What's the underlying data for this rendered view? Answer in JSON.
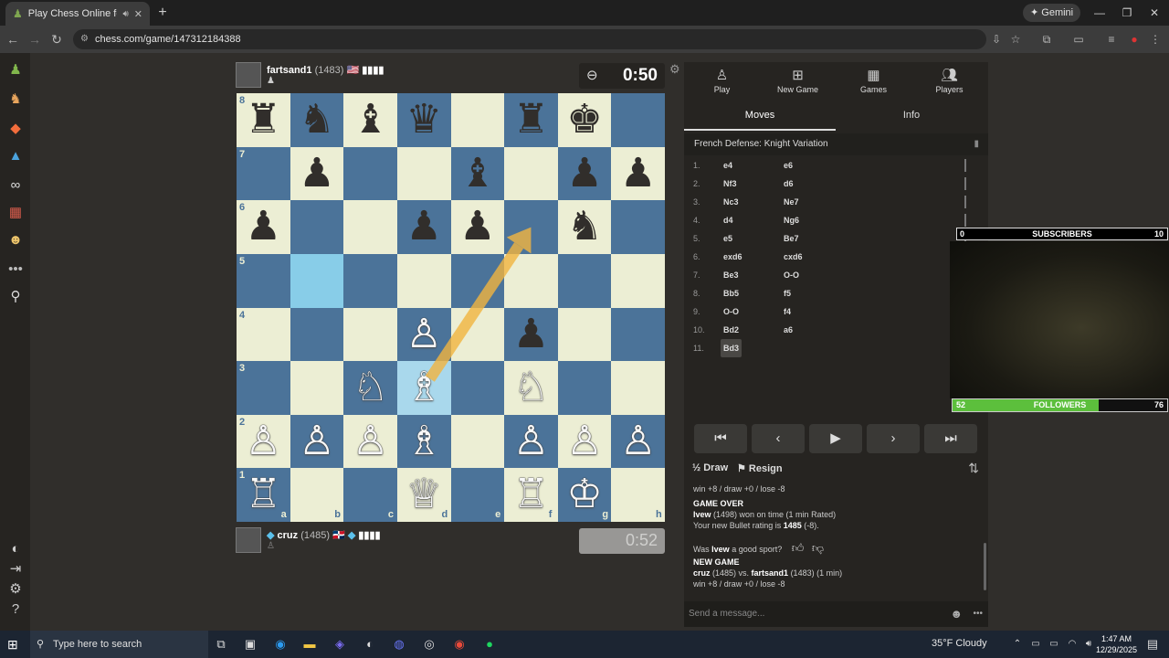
{
  "browser": {
    "tab_title": "Play Chess Online for FREE",
    "new_tab": "+",
    "gemini": "Gemini",
    "url": "chess.com/game/147312184388"
  },
  "top_player": {
    "name": "fartsand1",
    "rating": "(1483)",
    "flag": "🇺🇸",
    "signal": "▮▮▮▮",
    "clock": "0:50"
  },
  "bottom_player": {
    "name": "cruz",
    "rating": "(1485)",
    "flag": "🇩🇴",
    "signal": "▮▮▮▮",
    "clock": "0:52"
  },
  "board": {
    "ranks": [
      "8",
      "7",
      "6",
      "5",
      "4",
      "3",
      "2",
      "1"
    ],
    "files": [
      "a",
      "b",
      "c",
      "d",
      "e",
      "f",
      "g",
      "h"
    ],
    "pieces": [
      [
        "♜",
        "♞",
        "♝",
        "♛",
        "",
        "♜",
        "♚",
        ""
      ],
      [
        "",
        "♟",
        "",
        "",
        "♝",
        "",
        "♟",
        "♟"
      ],
      [
        "♟",
        "",
        "",
        "♟",
        "♟",
        "",
        "♞",
        ""
      ],
      [
        "",
        "",
        "",
        "",
        "",
        "",
        "",
        ""
      ],
      [
        "",
        "",
        "",
        "♙",
        "",
        "♟",
        "",
        ""
      ],
      [
        "",
        "",
        "♘",
        "♗",
        "",
        "♘",
        "",
        ""
      ],
      [
        "♙",
        "♙",
        "♙",
        "♗",
        "",
        "♙",
        "♙",
        "♙"
      ],
      [
        "♖",
        "",
        "",
        "♕",
        "",
        "♖",
        "♔",
        ""
      ]
    ],
    "colors": [
      [
        "b",
        "b",
        "b",
        "b",
        "",
        "b",
        "b",
        ""
      ],
      [
        "",
        "b",
        "",
        "",
        "b",
        "",
        "b",
        "b"
      ],
      [
        "b",
        "",
        "",
        "b",
        "b",
        "",
        "b",
        ""
      ],
      [
        "",
        "",
        "",
        "",
        "",
        "",
        "",
        ""
      ],
      [
        "",
        "",
        "",
        "w",
        "",
        "b",
        "",
        ""
      ],
      [
        "",
        "",
        "w",
        "w",
        "",
        "w",
        "",
        ""
      ],
      [
        "w",
        "w",
        "w",
        "w",
        "",
        "w",
        "w",
        "w"
      ],
      [
        "w",
        "",
        "",
        "w",
        "",
        "w",
        "w",
        ""
      ]
    ],
    "highlights": [
      "b5",
      "d3"
    ],
    "arrow": {
      "from": "d3",
      "to": "f6",
      "color": "#f2b540"
    }
  },
  "panel": {
    "tabs": [
      {
        "label": "Play",
        "icon": "pawn-icon"
      },
      {
        "label": "New Game",
        "icon": "plus-icon"
      },
      {
        "label": "Games",
        "icon": "board-icon"
      },
      {
        "label": "Players",
        "icon": "players-icon"
      }
    ],
    "subtabs": [
      "Moves",
      "Info"
    ],
    "opening": "French Defense: Knight Variation",
    "moves": [
      {
        "num": "1.",
        "w": "e4",
        "b": "e6"
      },
      {
        "num": "2.",
        "w": "Nf3",
        "b": "d6"
      },
      {
        "num": "3.",
        "w": "Nc3",
        "b": "Ne7"
      },
      {
        "num": "4.",
        "w": "d4",
        "b": "Ng6"
      },
      {
        "num": "5.",
        "w": "e5",
        "b": "Be7"
      },
      {
        "num": "6.",
        "w": "exd6",
        "b": "cxd6"
      },
      {
        "num": "7.",
        "w": "Be3",
        "b": "O-O"
      },
      {
        "num": "8.",
        "w": "Bb5",
        "b": "f5"
      },
      {
        "num": "9.",
        "w": "O-O",
        "b": "f4"
      },
      {
        "num": "10.",
        "w": "Bd2",
        "b": "a6"
      },
      {
        "num": "11.",
        "w": "Bd3",
        "b": ""
      }
    ],
    "draw": "Draw",
    "resign": "Resign",
    "chat": {
      "line0": "win +8 / draw +0 / lose -8",
      "game_over": "GAME OVER",
      "result_name": "lvew",
      "result_text": " (1498) won on time (1 min Rated)",
      "rating_text": "Your new Bullet rating is ",
      "rating_value": "1485",
      "rating_delta": " (-8).",
      "sport_q1": "Was ",
      "sport_name": "lvew",
      "sport_q2": " a good sport?",
      "new_game": "NEW GAME",
      "ng_p1": "cruz",
      "ng_mid1": " (1485) vs. ",
      "ng_p2": "fartsand1",
      "ng_mid2": " (1483) (1 min)",
      "ng_odds": "win +8 / draw +0 / lose -8"
    },
    "chat_placeholder": "Send a message..."
  },
  "overlay": {
    "subscribers_label": "SUBSCRIBERS",
    "subscribers_left": "0",
    "subscribers_right": "10",
    "followers_label": "FOLLOWERS",
    "followers_left": "52",
    "followers_right": "76",
    "followers_progress": 0.68
  },
  "taskbar": {
    "search_placeholder": "Type here to search",
    "weather": "35°F  Cloudy",
    "time": "1:47 AM",
    "date": "12/29/2025"
  }
}
